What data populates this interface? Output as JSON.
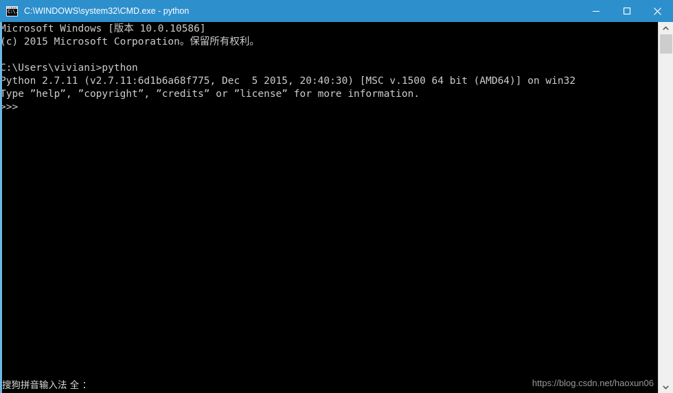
{
  "window": {
    "title": "C:\\WINDOWS\\system32\\CMD.exe - python",
    "icon": "cmd-console-icon",
    "icon_glyph": "C:\\.",
    "titlebar_color": "#2d8fcc",
    "client_bg_color": "#000000",
    "text_color": "#cccccc",
    "controls": [
      {
        "name": "minimize-button",
        "label": "—"
      },
      {
        "name": "maximize-button",
        "label": "☐"
      },
      {
        "name": "close-button",
        "label": "✕"
      }
    ]
  },
  "console": {
    "lines": [
      "Microsoft Windows [版本 10.0.10586]",
      "(c) 2015 Microsoft Corporation。保留所有权利。",
      "",
      "C:\\Users\\viviani>python",
      "Python 2.7.11 (v2.7.11:6d1b6a68f775, Dec  5 2015, 20:40:30) [MSC v.1500 64 bit (AMD64)] on win32",
      "Type ”help”, ”copyright”, ”credits” or ”license” for more information.",
      ">>>"
    ],
    "text": "Microsoft Windows [版本 10.0.10586]\n(c) 2015 Microsoft Corporation。保留所有权利。\n\nC:\\Users\\viviani>python\nPython 2.7.11 (v2.7.11:6d1b6a68f775, Dec  5 2015, 20:40:30) [MSC v.1500 64 bit (AMD64)] on win32\nType ”help”, ”copyright”, ”credits” or ”license” for more information.\n>>>",
    "prompt": ">>>",
    "os_version": "10.0.10586",
    "python_version": "2.7.11",
    "python_build": "v2.7.11:6d1b6a68f775",
    "python_build_date": "Dec  5 2015, 20:40:30",
    "python_compiler": "MSC v.1500 64 bit (AMD64)",
    "platform": "win32",
    "current_directory": "C:\\Users\\viviani",
    "command_entered": "python"
  },
  "ime": {
    "status_text": "搜狗拼音输入法 全 ："
  },
  "watermark": {
    "url": "https://blog.csdn.net/haoxun06"
  },
  "scrollbar": {
    "up_arrow": "▲",
    "down_arrow": "▼",
    "track_color": "#f0f0f0",
    "thumb_color": "#cdcdcd"
  }
}
